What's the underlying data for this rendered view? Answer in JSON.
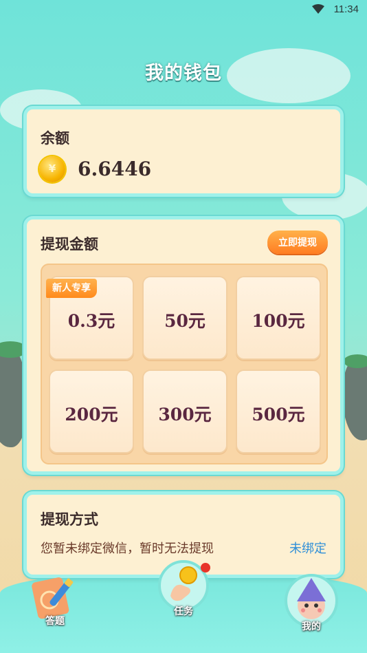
{
  "status_bar": {
    "time": "11:34"
  },
  "page": {
    "title": "我的钱包"
  },
  "balance": {
    "heading": "余额",
    "coin_symbol": "¥",
    "value": "6.6446"
  },
  "withdraw": {
    "heading": "提现金额",
    "withdraw_now_label": "立即提现",
    "newbie_tag": "新人专享",
    "options": [
      "0.3元",
      "50元",
      "100元",
      "200元",
      "300元",
      "500元"
    ]
  },
  "method": {
    "heading": "提现方式",
    "description": "您暂未绑定微信，暂时无法提现",
    "unbound_label": "未绑定"
  },
  "nav": {
    "answer_label": "答题",
    "task_label": "任务",
    "mine_label": "我的"
  }
}
